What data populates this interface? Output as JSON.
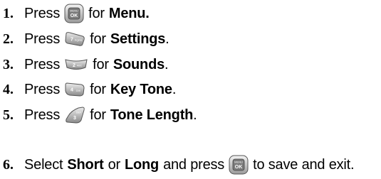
{
  "steps": [
    {
      "number": "1.",
      "prefix": "Press",
      "key_icon": "menu-ok-key-icon",
      "key_top_label": "MENU",
      "key_main_label": "OK",
      "mid": "for",
      "target": "Menu."
    },
    {
      "number": "2.",
      "prefix": "Press",
      "key_icon": "7pqrs-key-icon",
      "key_main_label": "7",
      "key_sub_label": "PQRS",
      "mid": "for",
      "target": "Settings",
      "suffix": "."
    },
    {
      "number": "3.",
      "prefix": "Press",
      "key_icon": "2abc-key-icon",
      "key_main_label": "2",
      "key_sub_label": "ABC",
      "mid": "for",
      "target": "Sounds",
      "suffix": "."
    },
    {
      "number": "4.",
      "prefix": "Press",
      "key_icon": "4ghi-key-icon",
      "key_main_label": "4",
      "key_sub_label": "GHI",
      "mid": "for",
      "target": "Key Tone",
      "suffix": "."
    },
    {
      "number": "5.",
      "prefix": "Press",
      "key_icon": "3def-key-icon",
      "key_main_label": "3",
      "key_sub_label": "DEF",
      "mid": "for",
      "target": "Tone Length",
      "suffix": "."
    },
    {
      "number": "6.",
      "prefix": "Select",
      "option_a": "Short",
      "or": "or",
      "option_b": "Long",
      "and_press": "and press",
      "key_icon": "menu-ok-key-icon",
      "key_top_label": "MENU",
      "key_main_label": "OK",
      "suffix": "to save and exit."
    }
  ]
}
